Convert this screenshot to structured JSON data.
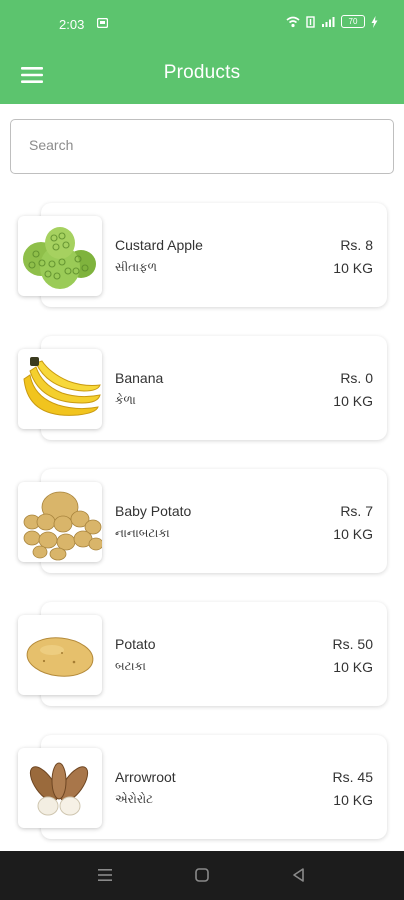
{
  "status_bar": {
    "time": "2:03",
    "battery": "70"
  },
  "app_bar": {
    "title": "Products"
  },
  "search": {
    "placeholder": "Search",
    "value": ""
  },
  "products": [
    {
      "name": "Custard Apple",
      "local_name": "સીતાફળ",
      "price": "Rs. 8",
      "quantity": "10 KG",
      "image": "custard-apple"
    },
    {
      "name": "Banana",
      "local_name": "કેળા",
      "price": "Rs. 0",
      "quantity": "10 KG",
      "image": "banana"
    },
    {
      "name": "Baby Potato",
      "local_name": "નાનાબટાકા",
      "price": "Rs. 7",
      "quantity": "10 KG",
      "image": "baby-potato"
    },
    {
      "name": "Potato",
      "local_name": "બટાકા",
      "price": "Rs. 50",
      "quantity": "10 KG",
      "image": "potato"
    },
    {
      "name": "Arrowroot",
      "local_name": "એરોરોટ",
      "price": "Rs. 45",
      "quantity": "10 KG",
      "image": "arrowroot"
    }
  ],
  "colors": {
    "primary": "#5cc46e",
    "nav_bar": "#1c1c1c"
  }
}
